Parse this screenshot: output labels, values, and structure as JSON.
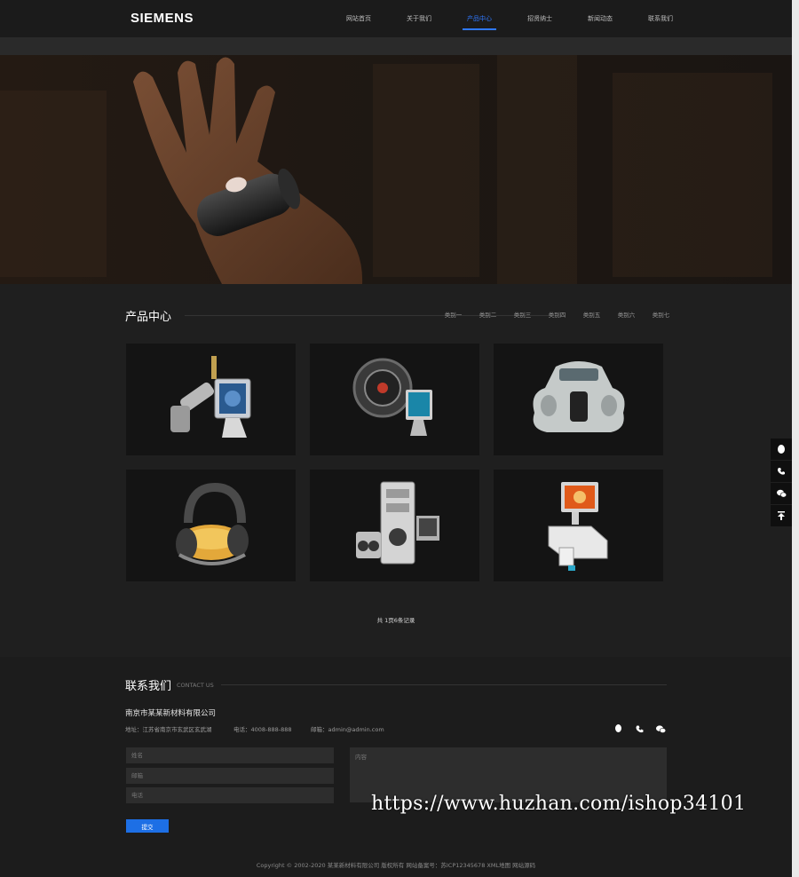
{
  "header": {
    "logo": "SIEMENS",
    "nav": [
      "网站首页",
      "关于我们",
      "产品中心",
      "招贤纳士",
      "新闻动态",
      "联系我们"
    ],
    "active_index": 2
  },
  "products": {
    "title": "产品中心",
    "categories": [
      "类别一",
      "类别二",
      "类别三",
      "类别四",
      "类别五",
      "类别六",
      "类别七"
    ],
    "items": [
      {
        "icon": "telescope-monitor-icon"
      },
      {
        "icon": "film-reel-monitor-icon"
      },
      {
        "icon": "vintage-car-icon"
      },
      {
        "icon": "headphones-icon"
      },
      {
        "icon": "computer-tower-icon"
      },
      {
        "icon": "kiosk-screen-icon"
      }
    ],
    "pager": "共 1页6条记录"
  },
  "float_bar": [
    "qq-icon",
    "phone-icon",
    "wechat-icon",
    "back-to-top-icon"
  ],
  "contact": {
    "title": "联系我们",
    "subtitle": "CONTACT US",
    "company": "南京市某某新材料有限公司",
    "address": "地址：江苏省南京市玄武区玄武湖",
    "phone": "电话：4008-888-888",
    "email": "邮箱：admin@admin.com",
    "social_colors": {
      "qq": "#ffffff",
      "phone": "#ffffff",
      "wechat": "#ffffff"
    },
    "form": {
      "name_placeholder": "姓名",
      "email_placeholder": "邮箱",
      "phone_placeholder": "电话",
      "content_placeholder": "内容",
      "submit_label": "提交"
    },
    "copyright": "Copyright © 2002-2020 某某新材料有限公司 版权所有 网站备案号：苏ICP12345678 XML地图 网站源码"
  },
  "watermark": "https://www.huzhan.com/ishop34101",
  "colors": {
    "accent": "#2f78ff",
    "button": "#1d6fe5"
  }
}
